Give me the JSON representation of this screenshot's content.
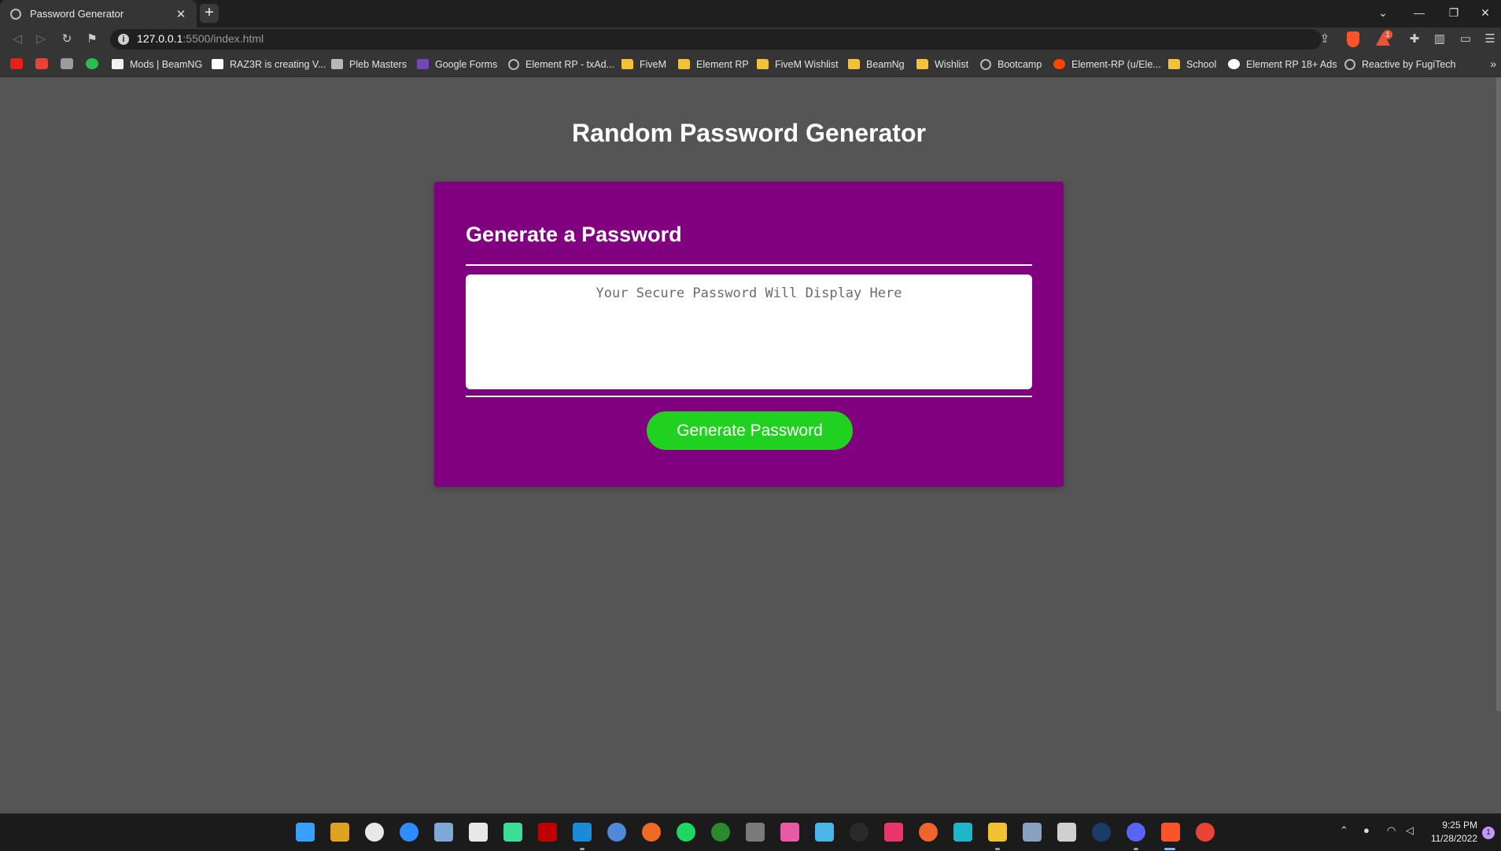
{
  "browser": {
    "tab_title": "Password Generator",
    "tab_close": "✕",
    "new_tab": "+",
    "url_host": "127.0.0.1",
    "url_port": ":5500",
    "url_path": "/index.html",
    "rewards_badge": "1",
    "window_controls": [
      "⌄",
      "—",
      "❐",
      "✕"
    ]
  },
  "bookmarks": [
    {
      "label": "Mods | BeamNG",
      "icon": "beamng-icon"
    },
    {
      "label": "RAZ3R is creating V...",
      "icon": "patreon-icon"
    },
    {
      "label": "Pleb Masters",
      "icon": "pleb-masters-icon"
    },
    {
      "label": "Google Forms",
      "icon": "google-forms-icon"
    },
    {
      "label": "Element RP - txAd...",
      "icon": "gear-icon"
    },
    {
      "label": "FiveM",
      "icon": "folder-icon"
    },
    {
      "label": "Element RP",
      "icon": "folder-icon"
    },
    {
      "label": "FiveM Wishlist",
      "icon": "folder-icon"
    },
    {
      "label": "BeamNg",
      "icon": "folder-icon"
    },
    {
      "label": "Wishlist",
      "icon": "folder-icon"
    },
    {
      "label": "Bootcamp",
      "icon": "globe-icon"
    },
    {
      "label": "Element-RP (u/Ele...",
      "icon": "reddit-icon"
    },
    {
      "label": "School",
      "icon": "folder-icon"
    },
    {
      "label": "Element RP 18+ Ads",
      "icon": "google-icon"
    },
    {
      "label": "Reactive by FugiTech",
      "icon": "globe-icon"
    }
  ],
  "page": {
    "title": "Random Password Generator",
    "card_title": "Generate a Password",
    "password_placeholder": "Your Secure Password Will Display Here",
    "password_value": "",
    "generate_button": "Generate Password"
  },
  "taskbar": {
    "time": "9:25 PM",
    "date": "11/28/2022",
    "notification_count": "1"
  },
  "colors": {
    "page_bg": "#555555",
    "card_bg": "#800080",
    "button_bg": "#20d11f",
    "text": "#ffffff"
  }
}
